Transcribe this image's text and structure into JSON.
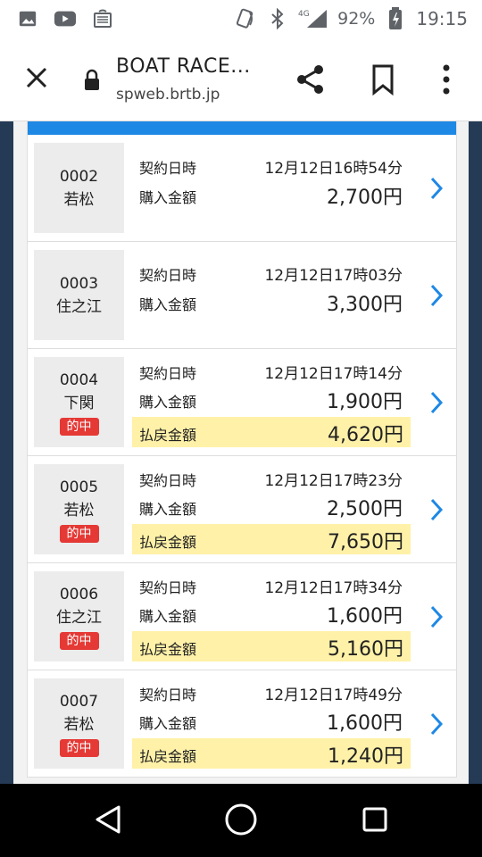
{
  "status_bar": {
    "battery": "92%",
    "time": "19:15",
    "network": "4G",
    "icons": [
      "image-icon",
      "youtube-icon",
      "cast-icon",
      "nfc-icon",
      "bluetooth-icon",
      "signal-icon",
      "battery-charging-icon"
    ]
  },
  "browser": {
    "title": "BOAT RACE...",
    "url": "spweb.brtb.jp",
    "close_icon": "close-icon",
    "share_icon": "share-icon",
    "bookmark_icon": "bookmark-icon",
    "menu_icon": "more-vert-icon"
  },
  "labels": {
    "contract_time": "契約日時",
    "purchase_amount": "購入金額",
    "payout_amount": "払戻金額",
    "hit_badge": "的中"
  },
  "colors": {
    "accent": "#1e88e5",
    "hit_badge": "#e53935",
    "payout_bg": "#fff1a8"
  },
  "rows": [
    {
      "number": "0002",
      "venue": "若松",
      "hit": false,
      "datetime": "12月12日16時54分",
      "purchase": "2,700円",
      "payout": ""
    },
    {
      "number": "0003",
      "venue": "住之江",
      "hit": false,
      "datetime": "12月12日17時03分",
      "purchase": "3,300円",
      "payout": ""
    },
    {
      "number": "0004",
      "venue": "下関",
      "hit": true,
      "datetime": "12月12日17時14分",
      "purchase": "1,900円",
      "payout": "4,620円"
    },
    {
      "number": "0005",
      "venue": "若松",
      "hit": true,
      "datetime": "12月12日17時23分",
      "purchase": "2,500円",
      "payout": "7,650円"
    },
    {
      "number": "0006",
      "venue": "住之江",
      "hit": true,
      "datetime": "12月12日17時34分",
      "purchase": "1,600円",
      "payout": "5,160円"
    },
    {
      "number": "0007",
      "venue": "若松",
      "hit": true,
      "datetime": "12月12日17時49分",
      "purchase": "1,600円",
      "payout": "1,240円"
    }
  ]
}
